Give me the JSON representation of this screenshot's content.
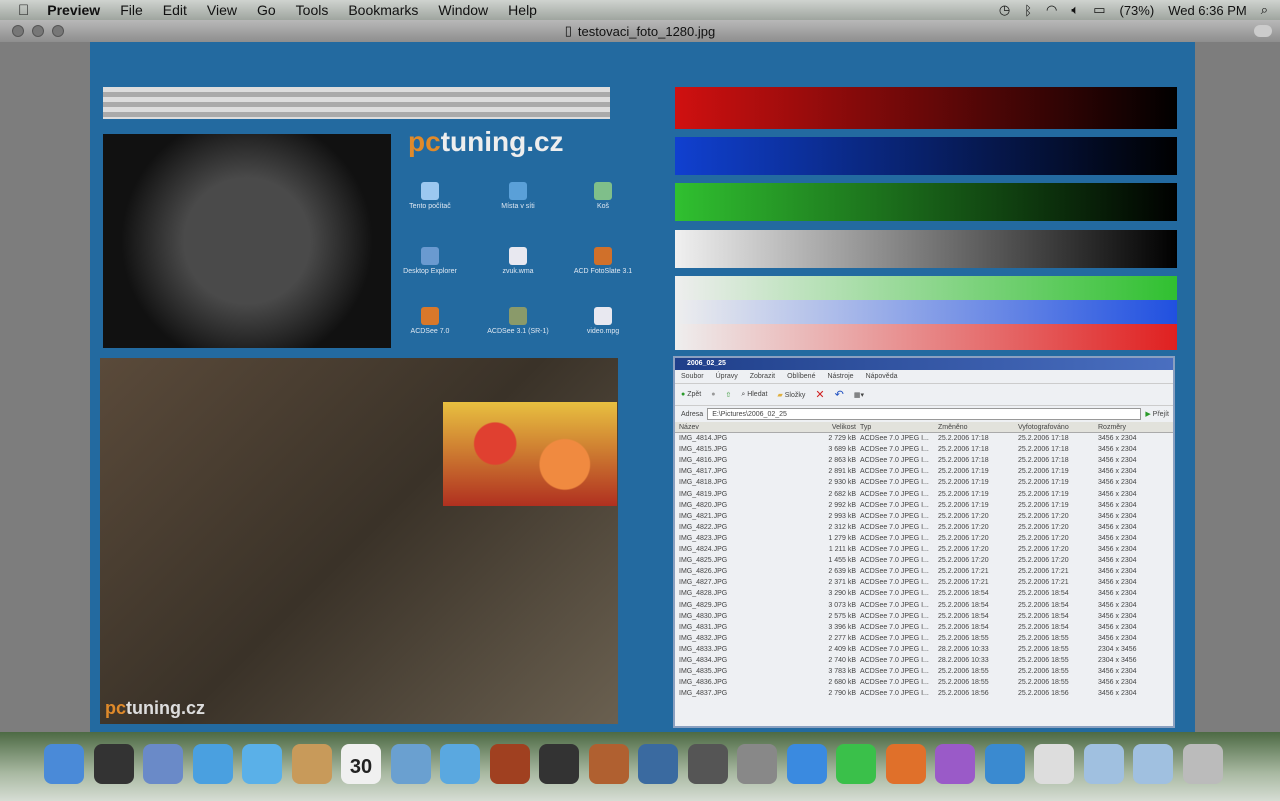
{
  "menubar": {
    "app": "Preview",
    "items": [
      "File",
      "Edit",
      "View",
      "Go",
      "Tools",
      "Bookmarks",
      "Window",
      "Help"
    ],
    "battery": "(73%)",
    "clock": "Wed 6:36 PM"
  },
  "window": {
    "title": "testovaci_foto_1280.jpg"
  },
  "image": {
    "logo": "pctuning.cz",
    "logo_bottom": "pctuning.cz",
    "desktop_icons": [
      {
        "label": "Tento počítač",
        "color": "#9cc8f0"
      },
      {
        "label": "Místa v síti",
        "color": "#5aa0d8"
      },
      {
        "label": "Koš",
        "color": "#7fbf8a"
      },
      {
        "label": "Desktop Explorer",
        "color": "#6a9ad0"
      },
      {
        "label": "zvuk.wma",
        "color": "#e8e8f0"
      },
      {
        "label": "ACD FotoSlate 3.1",
        "color": "#d0702a"
      },
      {
        "label": "ACDSee 7.0",
        "color": "#d8782a"
      },
      {
        "label": "ACDSee 3.1 (SR-1)",
        "color": "#8a9a6a"
      },
      {
        "label": "video.mpg",
        "color": "#e8e8f0"
      }
    ],
    "explorer": {
      "title": "2006_02_25",
      "menu": [
        "Soubor",
        "Úpravy",
        "Zobrazit",
        "Oblíbené",
        "Nástroje",
        "Nápověda"
      ],
      "toolbar": {
        "back": "Zpět",
        "search": "Hledat",
        "folders": "Složky"
      },
      "address_label": "Adresa",
      "address": "E:\\Pictures\\2006_02_25",
      "go": "Přejít",
      "columns": [
        "Název",
        "Velikost",
        "Typ",
        "Změněno",
        "Vyfotografováno",
        "Rozměry"
      ],
      "rows": [
        [
          "IMG_4814.JPG",
          "2 729 kB",
          "ACDSee 7.0 JPEG I...",
          "25.2.2006 17:18",
          "25.2.2006 17:18",
          "3456 x 2304"
        ],
        [
          "IMG_4815.JPG",
          "3 689 kB",
          "ACDSee 7.0 JPEG I...",
          "25.2.2006 17:18",
          "25.2.2006 17:18",
          "3456 x 2304"
        ],
        [
          "IMG_4816.JPG",
          "2 863 kB",
          "ACDSee 7.0 JPEG I...",
          "25.2.2006 17:18",
          "25.2.2006 17:18",
          "3456 x 2304"
        ],
        [
          "IMG_4817.JPG",
          "2 891 kB",
          "ACDSee 7.0 JPEG I...",
          "25.2.2006 17:19",
          "25.2.2006 17:19",
          "3456 x 2304"
        ],
        [
          "IMG_4818.JPG",
          "2 930 kB",
          "ACDSee 7.0 JPEG I...",
          "25.2.2006 17:19",
          "25.2.2006 17:19",
          "3456 x 2304"
        ],
        [
          "IMG_4819.JPG",
          "2 682 kB",
          "ACDSee 7.0 JPEG I...",
          "25.2.2006 17:19",
          "25.2.2006 17:19",
          "3456 x 2304"
        ],
        [
          "IMG_4820.JPG",
          "2 992 kB",
          "ACDSee 7.0 JPEG I...",
          "25.2.2006 17:19",
          "25.2.2006 17:19",
          "3456 x 2304"
        ],
        [
          "IMG_4821.JPG",
          "2 993 kB",
          "ACDSee 7.0 JPEG I...",
          "25.2.2006 17:20",
          "25.2.2006 17:20",
          "3456 x 2304"
        ],
        [
          "IMG_4822.JPG",
          "2 312 kB",
          "ACDSee 7.0 JPEG I...",
          "25.2.2006 17:20",
          "25.2.2006 17:20",
          "3456 x 2304"
        ],
        [
          "IMG_4823.JPG",
          "1 279 kB",
          "ACDSee 7.0 JPEG I...",
          "25.2.2006 17:20",
          "25.2.2006 17:20",
          "3456 x 2304"
        ],
        [
          "IMG_4824.JPG",
          "1 211 kB",
          "ACDSee 7.0 JPEG I...",
          "25.2.2006 17:20",
          "25.2.2006 17:20",
          "3456 x 2304"
        ],
        [
          "IMG_4825.JPG",
          "1 455 kB",
          "ACDSee 7.0 JPEG I...",
          "25.2.2006 17:20",
          "25.2.2006 17:20",
          "3456 x 2304"
        ],
        [
          "IMG_4826.JPG",
          "2 639 kB",
          "ACDSee 7.0 JPEG I...",
          "25.2.2006 17:21",
          "25.2.2006 17:21",
          "3456 x 2304"
        ],
        [
          "IMG_4827.JPG",
          "2 371 kB",
          "ACDSee 7.0 JPEG I...",
          "25.2.2006 17:21",
          "25.2.2006 17:21",
          "3456 x 2304"
        ],
        [
          "IMG_4828.JPG",
          "3 290 kB",
          "ACDSee 7.0 JPEG I...",
          "25.2.2006 18:54",
          "25.2.2006 18:54",
          "3456 x 2304"
        ],
        [
          "IMG_4829.JPG",
          "3 073 kB",
          "ACDSee 7.0 JPEG I...",
          "25.2.2006 18:54",
          "25.2.2006 18:54",
          "3456 x 2304"
        ],
        [
          "IMG_4830.JPG",
          "2 575 kB",
          "ACDSee 7.0 JPEG I...",
          "25.2.2006 18:54",
          "25.2.2006 18:54",
          "3456 x 2304"
        ],
        [
          "IMG_4831.JPG",
          "3 396 kB",
          "ACDSee 7.0 JPEG I...",
          "25.2.2006 18:54",
          "25.2.2006 18:54",
          "3456 x 2304"
        ],
        [
          "IMG_4832.JPG",
          "2 277 kB",
          "ACDSee 7.0 JPEG I...",
          "25.2.2006 18:55",
          "25.2.2006 18:55",
          "3456 x 2304"
        ],
        [
          "IMG_4833.JPG",
          "2 409 kB",
          "ACDSee 7.0 JPEG I...",
          "28.2.2006 10:33",
          "25.2.2006 18:55",
          "2304 x 3456"
        ],
        [
          "IMG_4834.JPG",
          "2 740 kB",
          "ACDSee 7.0 JPEG I...",
          "28.2.2006 10:33",
          "25.2.2006 18:55",
          "2304 x 3456"
        ],
        [
          "IMG_4835.JPG",
          "3 783 kB",
          "ACDSee 7.0 JPEG I...",
          "25.2.2006 18:55",
          "25.2.2006 18:55",
          "3456 x 2304"
        ],
        [
          "IMG_4836.JPG",
          "2 680 kB",
          "ACDSee 7.0 JPEG I...",
          "25.2.2006 18:55",
          "25.2.2006 18:55",
          "3456 x 2304"
        ],
        [
          "IMG_4837.JPG",
          "2 790 kB",
          "ACDSee 7.0 JPEG I...",
          "25.2.2006 18:56",
          "25.2.2006 18:56",
          "3456 x 2304"
        ]
      ]
    }
  },
  "dock": {
    "calendar_day": "30",
    "items": [
      "finder",
      "dashboard",
      "mail",
      "safari",
      "ichat",
      "address-book",
      "ical",
      "iphoto",
      "itunes",
      "photo-booth",
      "imovie",
      "garageband",
      "spaces",
      "time-machine",
      "system-preferences",
      "word",
      "excel",
      "powerpoint",
      "entourage",
      "messenger",
      "office-folder",
      "documents",
      "downloads",
      "trash"
    ],
    "colors": [
      "#4a8ad8",
      "#333",
      "#6a8ac8",
      "#4aa0e0",
      "#5ab0e8",
      "#c89a5a",
      "#f0f0f0",
      "#6aa0d0",
      "#5aa8e0",
      "#a04020",
      "#333",
      "#b06030",
      "#3a6aa0",
      "#555",
      "#888",
      "#3a8ae0",
      "#3ac04a",
      "#e0702a",
      "#9a5ac8",
      "#3a8ad0",
      "#ddd",
      "#a0c0e0",
      "#a0c0e0",
      "#bbb"
    ]
  }
}
